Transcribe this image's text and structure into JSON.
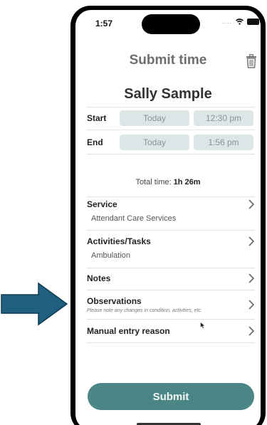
{
  "status_bar": {
    "time": "1:57"
  },
  "header": {
    "title": "Submit time"
  },
  "person": {
    "name": "Sally Sample"
  },
  "start": {
    "label": "Start",
    "date": "Today",
    "time": "12:30 pm"
  },
  "end": {
    "label": "End",
    "date": "Today",
    "time": "1:56 pm"
  },
  "total": {
    "prefix": "Total time: ",
    "value": "1h 26m"
  },
  "menu": {
    "service": {
      "title": "Service",
      "value": "Attendant Care Services"
    },
    "activities": {
      "title": "Activities/Tasks",
      "value": "Ambulation"
    },
    "notes": {
      "title": "Notes"
    },
    "observations": {
      "title": "Observations",
      "hint": "Please note any changes in condition, activities, etc."
    },
    "manual": {
      "title": "Manual entry reason"
    }
  },
  "submit": {
    "label": "Submit"
  },
  "colors": {
    "accent": "#4c8585",
    "arrow": "#1f5f80",
    "pill_bg": "#dde6e6"
  },
  "icons": {
    "trash": "trash-icon",
    "chevron": "chevron-right-icon",
    "arrow": "arrow-right-icon"
  }
}
